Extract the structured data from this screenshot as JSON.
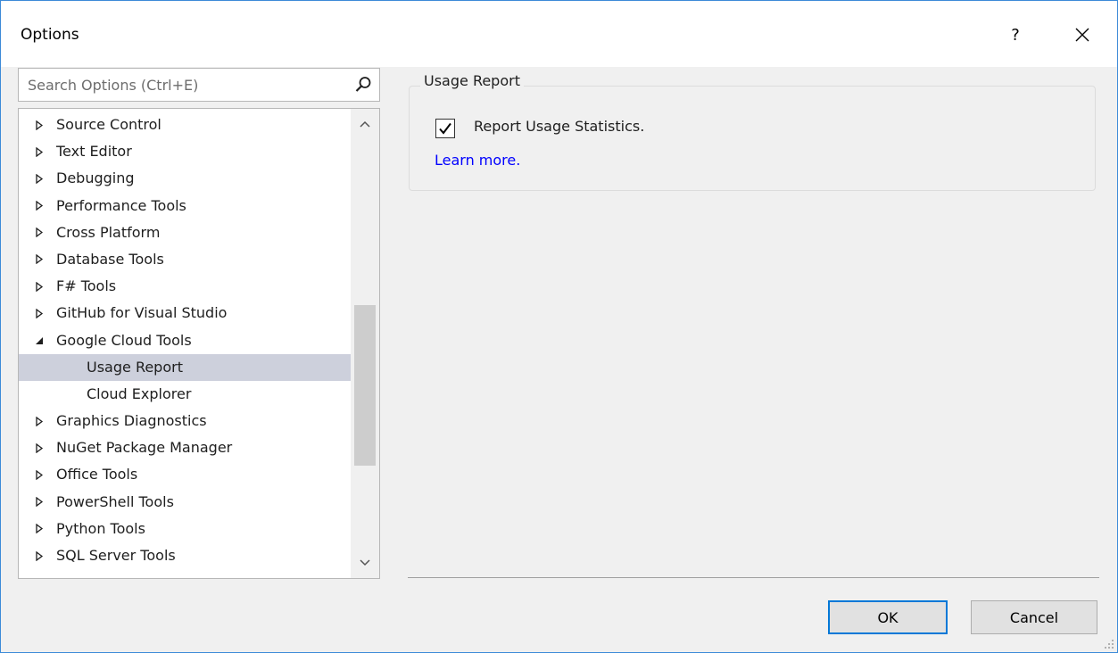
{
  "window": {
    "title": "Options",
    "help_label": "?"
  },
  "search": {
    "placeholder": "Search Options (Ctrl+E)",
    "value": ""
  },
  "tree": {
    "items": [
      {
        "label": "Source Control",
        "expander": "collapsed",
        "level": 0,
        "selected": false
      },
      {
        "label": "Text Editor",
        "expander": "collapsed",
        "level": 0,
        "selected": false
      },
      {
        "label": "Debugging",
        "expander": "collapsed",
        "level": 0,
        "selected": false
      },
      {
        "label": "Performance Tools",
        "expander": "collapsed",
        "level": 0,
        "selected": false
      },
      {
        "label": "Cross Platform",
        "expander": "collapsed",
        "level": 0,
        "selected": false
      },
      {
        "label": "Database Tools",
        "expander": "collapsed",
        "level": 0,
        "selected": false
      },
      {
        "label": "F# Tools",
        "expander": "collapsed",
        "level": 0,
        "selected": false
      },
      {
        "label": "GitHub for Visual Studio",
        "expander": "collapsed",
        "level": 0,
        "selected": false
      },
      {
        "label": "Google Cloud Tools",
        "expander": "expanded",
        "level": 0,
        "selected": false
      },
      {
        "label": "Usage Report",
        "expander": "none",
        "level": 1,
        "selected": true
      },
      {
        "label": "Cloud Explorer",
        "expander": "none",
        "level": 1,
        "selected": false
      },
      {
        "label": "Graphics Diagnostics",
        "expander": "collapsed",
        "level": 0,
        "selected": false
      },
      {
        "label": "NuGet Package Manager",
        "expander": "collapsed",
        "level": 0,
        "selected": false
      },
      {
        "label": "Office Tools",
        "expander": "collapsed",
        "level": 0,
        "selected": false
      },
      {
        "label": "PowerShell Tools",
        "expander": "collapsed",
        "level": 0,
        "selected": false
      },
      {
        "label": "Python Tools",
        "expander": "collapsed",
        "level": 0,
        "selected": false
      },
      {
        "label": "SQL Server Tools",
        "expander": "collapsed",
        "level": 0,
        "selected": false
      }
    ]
  },
  "panel": {
    "group_title": "Usage Report",
    "checkbox_label": "Report Usage Statistics.",
    "checkbox_checked": true,
    "link_text": "Learn more."
  },
  "buttons": {
    "ok": "OK",
    "cancel": "Cancel"
  },
  "colors": {
    "accent": "#0078d7",
    "selection": "#cdd0dc",
    "link": "#0000ff",
    "window_border": "#3c8ad8"
  },
  "icons": {
    "search": "search-icon",
    "close": "close-icon",
    "collapsed": "expander-collapsed-icon",
    "expanded": "expander-expanded-icon",
    "scroll_up": "chevron-up-icon",
    "scroll_down": "chevron-down-icon",
    "check": "checkmark-icon",
    "grip": "resize-grip-icon"
  }
}
